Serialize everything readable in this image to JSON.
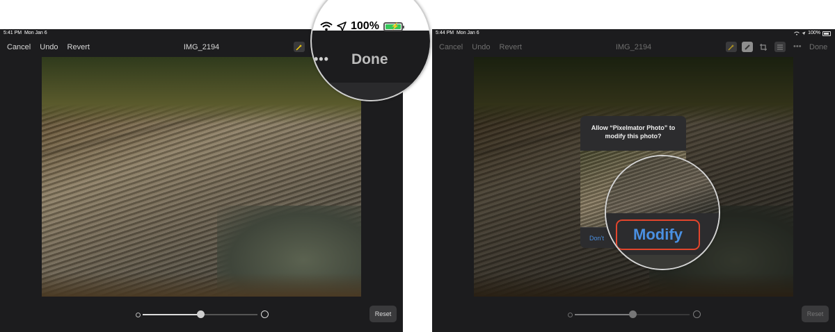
{
  "left_screen": {
    "status": {
      "time": "5:41 PM",
      "date": "Mon Jan 6"
    },
    "toolbar": {
      "cancel": "Cancel",
      "undo": "Undo",
      "revert": "Revert",
      "title": "IMG_2194"
    },
    "bottom": {
      "reset": "Reset",
      "slider_value": 0.5
    },
    "magnifier": {
      "battery": "100%",
      "more": "•••",
      "done": "Done"
    }
  },
  "right_screen": {
    "status": {
      "time": "5:44 PM",
      "date": "Mon Jan 6",
      "battery": "100%"
    },
    "toolbar": {
      "cancel": "Cancel",
      "undo": "Undo",
      "revert": "Revert",
      "title": "IMG_2194",
      "more": "•••",
      "done": "Done"
    },
    "bottom": {
      "reset": "Reset",
      "slider_value": 0.5
    },
    "alert": {
      "message": "Allow “Pixelmator Photo” to modify this photo?",
      "dont_allow": "Don’t",
      "modify": "Modify"
    }
  },
  "colors": {
    "accent": "#4a90e2",
    "highlight": "#e3452c",
    "battery": "#34c759",
    "tool_active": "#ffd60a"
  },
  "icons": [
    "wifi-icon",
    "location-arrow-icon",
    "battery-icon",
    "auto-enhance-icon",
    "brush-icon",
    "crop-icon",
    "adjust-icon"
  ]
}
